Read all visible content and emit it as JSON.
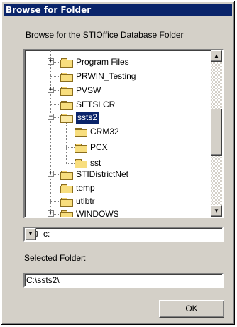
{
  "window": {
    "title": "Browse for Folder"
  },
  "prompt": "Browse for the STIOffice Database Folder",
  "tree": {
    "items": [
      {
        "label": "Program Files",
        "expander": "+"
      },
      {
        "label": "PRWIN_Testing",
        "expander": ""
      },
      {
        "label": "PVSW",
        "expander": "+"
      },
      {
        "label": "SETSLCR",
        "expander": ""
      },
      {
        "label": "ssts2",
        "expander": "−",
        "selected": true
      },
      {
        "label": "CRM32",
        "expander": ""
      },
      {
        "label": "PCX",
        "expander": ""
      },
      {
        "label": "sst",
        "expander": ""
      },
      {
        "label": "STIDistrictNet",
        "expander": "+"
      },
      {
        "label": "temp",
        "expander": ""
      },
      {
        "label": "utlbtr",
        "expander": ""
      },
      {
        "label": "WINDOWS",
        "expander": "+"
      }
    ],
    "scroll_up_icon": "arrow-up-icon",
    "scroll_down_icon": "arrow-down-icon"
  },
  "drive": {
    "value": "c:",
    "icon": "drive-icon"
  },
  "selected_folder": {
    "label": "Selected Folder:",
    "value": "C:\\ssts2\\"
  },
  "buttons": {
    "ok": "OK"
  },
  "colors": {
    "title_bar": "#0a246a",
    "dialog_bg": "#d4d0c8",
    "selection": "#0a246a"
  }
}
